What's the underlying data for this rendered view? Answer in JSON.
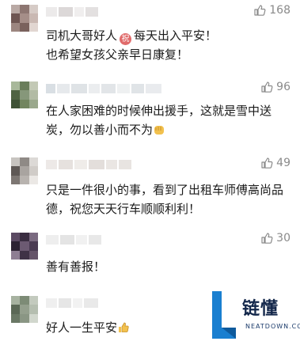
{
  "comments": [
    {
      "likes": "168",
      "text_before_badge": "司机大哥好人",
      "badge": "祝",
      "text_after_badge": "每天出入平安！",
      "line2": "也希望女孩父亲早日康复！"
    },
    {
      "likes": "96",
      "line1": "在人家困难的时候伸出援手，这就是雪中送",
      "line2": "炭，勿以善小而不为"
    },
    {
      "likes": "49",
      "line1": "只是一件很小的事，看到了出租车师傅高尚品",
      "line2": "德，祝您天天行车顺顺利利！"
    },
    {
      "likes": "30",
      "line1": "善有善报！"
    },
    {
      "likes": "",
      "line1": "好人一生平安"
    }
  ],
  "watermark": {
    "title": "链懂",
    "subtitle": "NEATDOWN.COM"
  },
  "colors": {
    "text": "#1b1b1b",
    "likes": "#8a8a8a",
    "watermark_blue": "#1a7fd0",
    "watermark_dark": "#12264a"
  }
}
